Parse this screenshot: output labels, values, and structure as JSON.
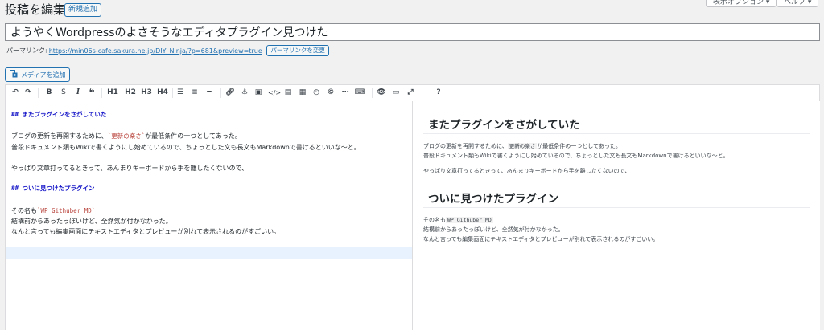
{
  "header": {
    "page_title": "投稿を編集",
    "new_post_button": "新規追加",
    "screen_options": "表示オプション ▾",
    "help": "ヘルプ ▾"
  },
  "post": {
    "title": "ようやくWordpressのよさそうなエディタプラグイン見つけた"
  },
  "permalink": {
    "label": "パーマリンク:",
    "url": "https://min06s-cafe.sakura.ne.jp/DIY_Ninja/?p=681&preview=true",
    "change_button": "パーマリンクを変更"
  },
  "media_button": {
    "label": "メディアを追加",
    "icon": "media-icon"
  },
  "toolbar": {
    "h1": "H1",
    "h2": "H2",
    "h3": "H3",
    "h4": "H4",
    "help": "?"
  },
  "markdown": {
    "line1": "## またプラグインをさがしていた",
    "line2a": "ブログの更新を再開するために、",
    "line2code": "`更新の楽さ`",
    "line2b": "が最低条件の一つとしてあった。",
    "line3": "普段ドキュメント類もWikiで書くようにし始めているので、ちょっとした文も長文もMarkdownで書けるといいな～と。",
    "line4": "やっぱり文章打ってるときって、あんまりキーボードから手を離したくないので、",
    "line5": "## ついに見つけたプラグイン",
    "line6a": "その名も",
    "line6code": "`WP Githuber MD`",
    "line7": "結構前からあったっぽいけど、全然気が付かなかった。",
    "line8": "なんと言っても編集画面にテキストエディタとプレビューが別れて表示されるのがすごいい。"
  },
  "preview": {
    "h1": "またプラグインをさがしていた",
    "p1a": "ブログの更新を再開するために、",
    "p1code": "更新の楽さ",
    "p1b": "が最低条件の一つとしてあった。",
    "p2": "普段ドキュメント類もWikiで書くようにし始めているので、ちょっとした文も長文もMarkdownで書けるといいな～と。",
    "p3": "やっぱり文章打ってるときって、あんまりキーボードから手を離したくないので、",
    "h2": "ついに見つけたプラグイン",
    "p4a": "その名も",
    "p4code": "WP Githuber MD",
    "p5": "結構前からあったっぽいけど、全然気が付かなかった。",
    "p6": "なんと言っても編集画面にテキストエディタとプレビューが別れて表示されるのがすごいい。"
  },
  "colors": {
    "accent": "#2271b1",
    "heading_md": "#1414c8",
    "code_md": "#b9433b",
    "active_line": "#e8f2fe"
  }
}
